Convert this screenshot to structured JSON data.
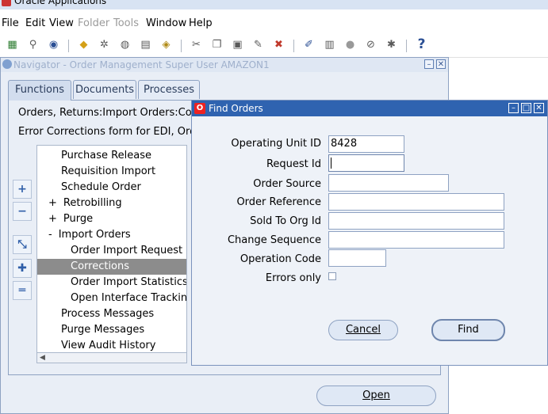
{
  "app": {
    "title": "Oracle Applications"
  },
  "menubar": {
    "items": [
      {
        "label": "File",
        "disabled": false
      },
      {
        "label": "Edit",
        "disabled": false
      },
      {
        "label": "View",
        "disabled": false
      },
      {
        "label": "Folder",
        "disabled": true
      },
      {
        "label": "Tools",
        "disabled": true
      },
      {
        "label": "Window",
        "disabled": false
      },
      {
        "label": "Help",
        "disabled": false
      }
    ]
  },
  "toolbar": {
    "icons": [
      "new-icon",
      "find-icon",
      "navigator-icon",
      "open-folder-icon",
      "save-icon",
      "next-step-icon",
      "print-icon",
      "close-form-icon",
      "cut-icon",
      "copy-icon",
      "paste-icon",
      "new-record-icon",
      "delete-record-icon",
      "edit-field-icon",
      "zoom-icon",
      "translations-icon",
      "attachments-icon",
      "folder-tools-icon",
      "help-icon"
    ]
  },
  "navigator": {
    "title": "Navigator - Order Management Super User AMAZON1",
    "tabs": [
      "Functions",
      "Documents",
      "Processes"
    ],
    "description_line1": "Orders, Returns:Import Orders:Correc",
    "description_line2": "Error Corrections form for EDI, Order I",
    "tree": [
      {
        "prefix": "",
        "label": "Purchase Release"
      },
      {
        "prefix": "",
        "label": "Requisition Import"
      },
      {
        "prefix": "",
        "label": "Schedule Order"
      },
      {
        "prefix": "+",
        "label": "Retrobilling"
      },
      {
        "prefix": "+",
        "label": "Purge"
      },
      {
        "prefix": "-",
        "label": "Import Orders"
      },
      {
        "prefix": "",
        "label": "Order Import Request"
      },
      {
        "prefix": "",
        "label": "Corrections"
      },
      {
        "prefix": "",
        "label": "Order Import Statistics"
      },
      {
        "prefix": "",
        "label": "Open Interface Tracking"
      },
      {
        "prefix": "",
        "label": "Process Messages"
      },
      {
        "prefix": "",
        "label": "Purge Messages"
      },
      {
        "prefix": "",
        "label": "View Audit History"
      }
    ],
    "open_label": "Open"
  },
  "find_dialog": {
    "title": "Find Orders",
    "fields": {
      "operating_unit_label": "Operating Unit ID",
      "operating_unit_value": "8428",
      "request_id_label": "Request Id",
      "request_id_value": "",
      "order_source_label": "Order Source",
      "order_source_value": "",
      "order_reference_label": "Order Reference",
      "order_reference_value": "",
      "sold_to_org_label": "Sold To Org Id",
      "sold_to_org_value": "",
      "change_sequence_label": "Change Sequence",
      "change_sequence_value": "",
      "operation_code_label": "Operation Code",
      "operation_code_value": "",
      "errors_only_label": "Errors only"
    },
    "cancel_label": "Cancel",
    "find_label": "Find"
  }
}
